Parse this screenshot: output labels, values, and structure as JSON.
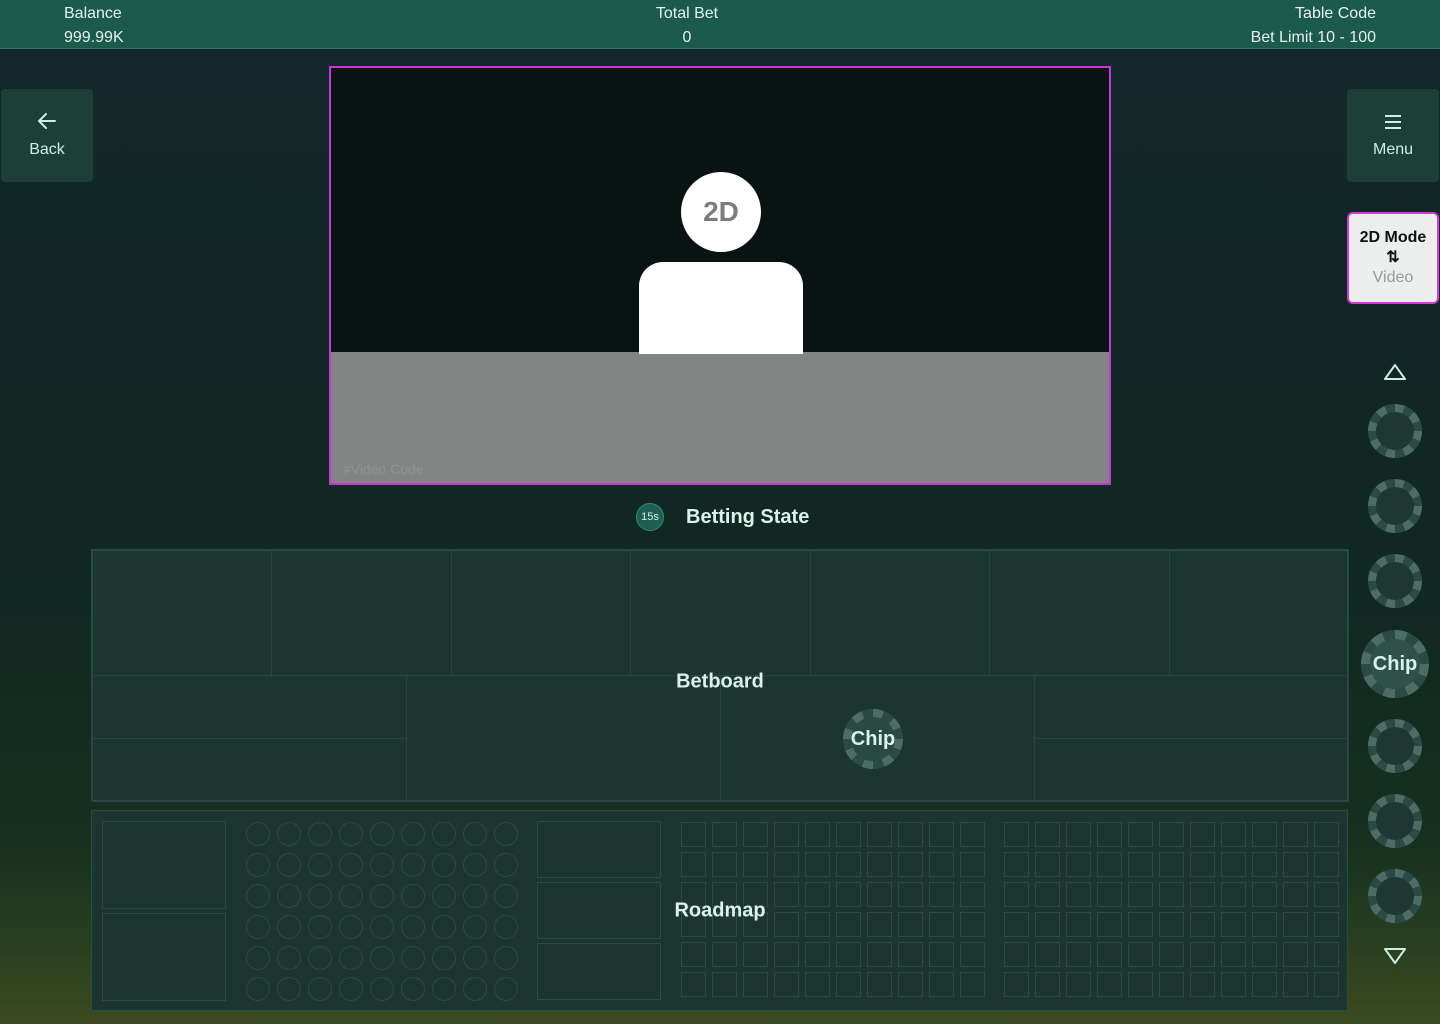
{
  "topbar": {
    "balance_label": "Balance",
    "balance_value": "999.99K",
    "total_bet_label": "Total Bet",
    "total_bet_value": "0",
    "table_code_label": "Table Code",
    "bet_limit": "Bet Limit 10 - 100"
  },
  "nav": {
    "back_label": "Back",
    "back_icon": "arrow-left-icon",
    "menu_label": "Menu",
    "menu_icon": "hamburger-icon"
  },
  "mode_toggle": {
    "active": "2D Mode",
    "swap_glyph": "⇅",
    "inactive": "Video"
  },
  "video": {
    "avatar_text": "2D",
    "code_text": "#Video Code"
  },
  "state": {
    "timer": "15s",
    "label": "Betting State"
  },
  "betboard": {
    "label": "Betboard",
    "chip_label": "Chip"
  },
  "roadmap": {
    "label": "Roadmap"
  },
  "chip_rail": {
    "selected_label": "Chip",
    "selected_index": 3,
    "count": 7
  },
  "colors": {
    "topbar": "#1c5a4c",
    "highlight_border": "#d22fd8",
    "panel": "#1b3530"
  }
}
